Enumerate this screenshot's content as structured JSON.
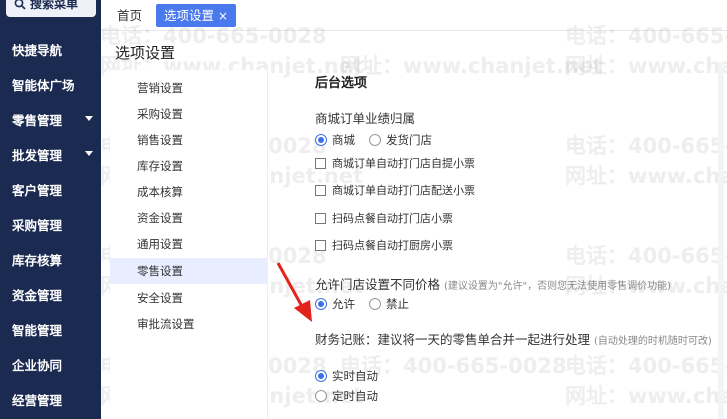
{
  "sidebar": {
    "search_label": "搜索菜单",
    "items": [
      {
        "label": "快捷导航"
      },
      {
        "label": "智能体广场"
      },
      {
        "label": "零售管理"
      },
      {
        "label": "批发管理"
      },
      {
        "label": "客户管理"
      },
      {
        "label": "采购管理"
      },
      {
        "label": "库存核算"
      },
      {
        "label": "资金管理"
      },
      {
        "label": "智能管理"
      },
      {
        "label": "企业协同"
      },
      {
        "label": "经营管理"
      }
    ]
  },
  "tabs": {
    "home": "首页",
    "active": "选项设置",
    "close_glyph": "×"
  },
  "page_title": "选项设置",
  "submenu": {
    "items": [
      {
        "label": "营销设置"
      },
      {
        "label": "采购设置"
      },
      {
        "label": "销售设置"
      },
      {
        "label": "库存设置"
      },
      {
        "label": "成本核算"
      },
      {
        "label": "资金设置"
      },
      {
        "label": "通用设置"
      },
      {
        "label": "零售设置"
      },
      {
        "label": "安全设置"
      },
      {
        "label": "审批流设置"
      }
    ],
    "active_index": 7
  },
  "content": {
    "section_title": "后台选项",
    "mall_order_label": "商城订单业绩归属",
    "mall_order_options": [
      {
        "label": "商城",
        "selected": true
      },
      {
        "label": "发货门店",
        "selected": false
      }
    ],
    "checkboxes": [
      {
        "label": "商城订单自动打门店自提小票",
        "checked": false
      },
      {
        "label": "商城订单自动打门店配送小票",
        "checked": false
      },
      {
        "label": "扫码点餐自动打门店小票",
        "checked": false
      },
      {
        "label": "扫码点餐自动打厨房小票",
        "checked": false
      }
    ],
    "price_label": "允许门店设置不同价格",
    "price_hint": "(建议设置为\"允许\"，否则您无法使用零售调价功能)",
    "price_options": [
      {
        "label": "允许",
        "selected": true
      },
      {
        "label": "禁止",
        "selected": false
      }
    ],
    "finance_label": "财务记账：建议将一天的零售单合并一起进行处理",
    "finance_hint": "(自动处理的时机随时可改)",
    "finance_options": [
      {
        "label": "实时自动",
        "selected": true
      },
      {
        "label": "定时自动",
        "selected": false
      }
    ]
  },
  "watermark": {
    "phone": "电话：400-665-0028",
    "site": "网址：www.chanjet.net"
  },
  "colors": {
    "sidebar_bg": "#1b2a50",
    "accent": "#3d6fe9",
    "active_tab": "#4a79ee",
    "submenu_active_bg": "#e8eeff",
    "arrow": "#e3241c"
  }
}
